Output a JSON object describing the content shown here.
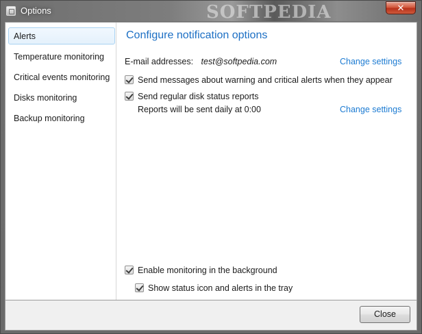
{
  "window": {
    "title": "Options",
    "watermark": "SOFTPEDIA",
    "close_glyph": "✕"
  },
  "sidebar": {
    "items": [
      {
        "label": "Alerts",
        "selected": true
      },
      {
        "label": "Temperature monitoring",
        "selected": false
      },
      {
        "label": "Critical events monitoring",
        "selected": false
      },
      {
        "label": "Disks monitoring",
        "selected": false
      },
      {
        "label": "Backup monitoring",
        "selected": false
      }
    ]
  },
  "alerts": {
    "heading": "Configure notification options",
    "email_label": "E-mail addresses:",
    "email_value": "test@softpedia.com",
    "change_settings_1": "Change settings",
    "warn_checkbox": {
      "label": "Send messages about warning and critical alerts when they appear",
      "checked": true
    },
    "report_checkbox": {
      "label": "Send regular disk status reports",
      "checked": true
    },
    "report_schedule": "Reports will be sent daily at 0:00",
    "change_settings_2": "Change settings",
    "background_checkbox": {
      "label": "Enable monitoring in the background",
      "checked": true
    },
    "tray_checkbox": {
      "label": "Show status icon and alerts in the tray",
      "checked": true
    }
  },
  "footer": {
    "close_label": "Close"
  },
  "colors": {
    "heading": "#1c6fc4",
    "link": "#1c7bd2",
    "selection_border": "#a8d2f2"
  }
}
